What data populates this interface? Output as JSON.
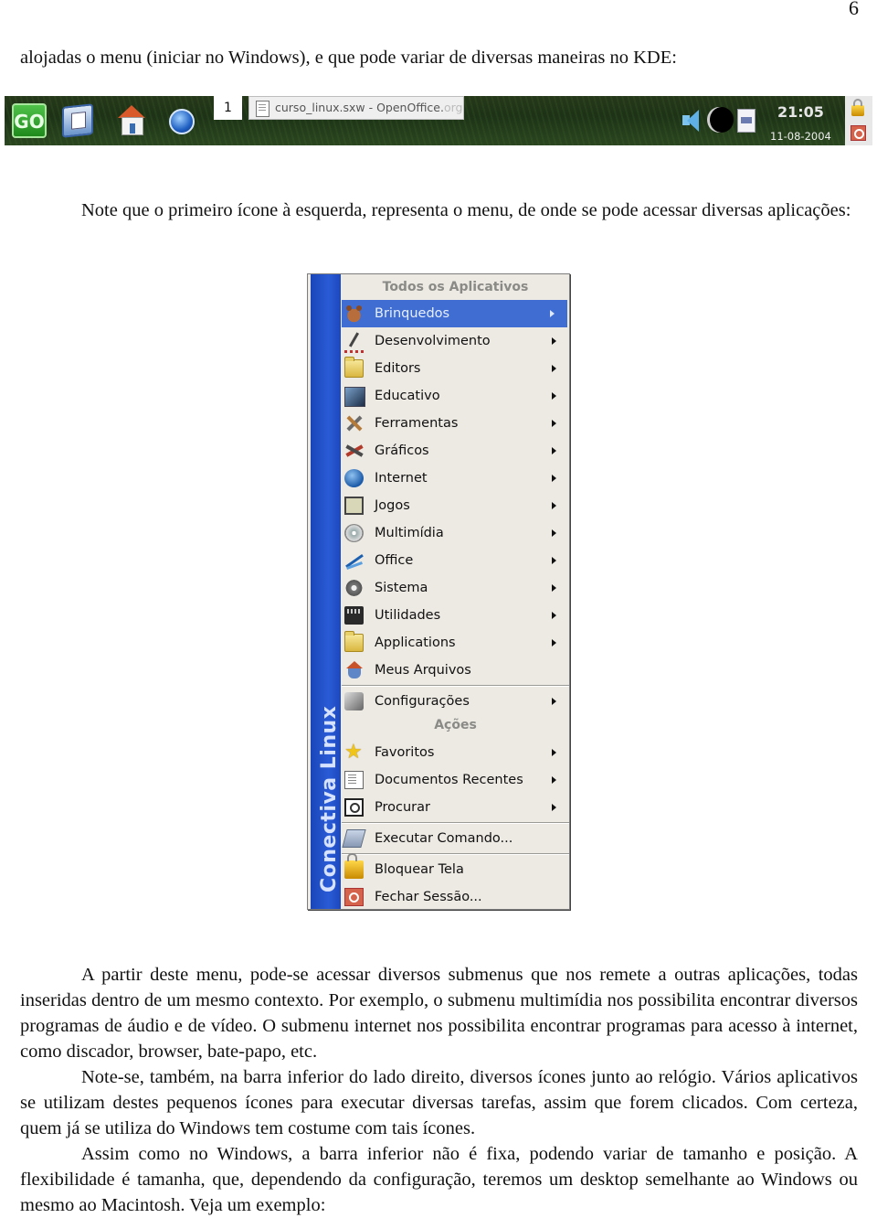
{
  "page": {
    "number": "6",
    "paragraphs": [
      "alojadas o menu (iniciar no Windows), e que pode variar de diversas maneiras no KDE:",
      "Note que o primeiro ícone à esquerda, representa o menu, de onde se pode acessar diversas aplicações:",
      "A partir deste menu, pode-se acessar diversos submenus que nos remete a outras aplicações, todas inseridas dentro de um mesmo contexto. Por exemplo, o submenu multimídia nos possibilita encontrar diversos programas de áudio e de vídeo. O submenu internet nos possibilita encontrar programas para acesso à internet, como discador, browser, bate-papo, etc.",
      "Note-se, também, na barra inferior do lado direito, diversos ícones junto ao relógio. Vários aplicativos se utilizam destes pequenos ícones para executar diversas tarefas, assim que forem clicados. Com certeza, quem já se utiliza do Windows tem costume com tais ícones.",
      "Assim como no Windows, a barra inferior não é fixa, podendo variar de tamanho e posição. A flexibilidade é tamanha, que, dependendo da configuração, teremos um desktop semelhante ao Windows ou mesmo ao Macintosh. Veja um exemplo:"
    ]
  },
  "taskbar": {
    "go_label": "GO",
    "launchers": [
      "desktop-icon",
      "home-icon",
      "browser-globe-icon"
    ],
    "desktop_number": "1",
    "task_title_main": "curso_linux.sxw - OpenOffice.",
    "task_title_faded": "org",
    "tray_icons": [
      "speaker-icon",
      "moon-icon",
      "window-icon"
    ],
    "clock_time": "21:05",
    "clock_date": "11-08-2004",
    "side_icons": [
      "lock-icon",
      "logout-icon"
    ]
  },
  "menu": {
    "sidebar_text": "Conectiva Linux",
    "title": "Todos os Aplicativos",
    "items": [
      {
        "label": "Brinquedos",
        "icon": "teddy-bear-icon",
        "submenu": true,
        "selected": true
      },
      {
        "label": "Desenvolvimento",
        "icon": "development-icon",
        "submenu": true
      },
      {
        "label": "Editors",
        "icon": "folder-icon",
        "submenu": true
      },
      {
        "label": "Educativo",
        "icon": "education-icon",
        "submenu": true
      },
      {
        "label": "Ferramentas",
        "icon": "tools-icon",
        "submenu": true
      },
      {
        "label": "Gráficos",
        "icon": "graphics-icon",
        "submenu": true
      },
      {
        "label": "Internet",
        "icon": "internet-icon",
        "submenu": true
      },
      {
        "label": "Jogos",
        "icon": "games-icon",
        "submenu": true
      },
      {
        "label": "Multimídia",
        "icon": "multimedia-icon",
        "submenu": true
      },
      {
        "label": "Office",
        "icon": "office-icon",
        "submenu": true
      },
      {
        "label": "Sistema",
        "icon": "system-icon",
        "submenu": true
      },
      {
        "label": "Utilidades",
        "icon": "utilities-icon",
        "submenu": true
      },
      {
        "label": "Applications",
        "icon": "folder-icon",
        "submenu": true
      },
      {
        "label": "Meus Arquivos",
        "icon": "home-icon",
        "submenu": false
      }
    ],
    "config_item": {
      "label": "Configurações",
      "icon": "settings-icon",
      "submenu": true
    },
    "actions_title": "Ações",
    "action_items": [
      {
        "label": "Favoritos",
        "icon": "star-icon",
        "submenu": true
      },
      {
        "label": "Documentos Recentes",
        "icon": "recent-documents-icon",
        "submenu": true
      },
      {
        "label": "Procurar",
        "icon": "search-icon",
        "submenu": true
      }
    ],
    "run_item": {
      "label": "Executar Comando...",
      "icon": "run-command-icon"
    },
    "session_items": [
      {
        "label": "Bloquear Tela",
        "icon": "lock-icon"
      },
      {
        "label": "Fechar Sessão...",
        "icon": "logout-icon"
      }
    ]
  }
}
